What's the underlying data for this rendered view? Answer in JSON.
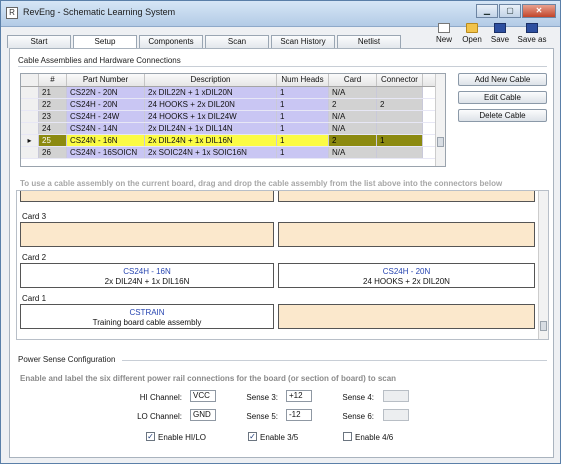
{
  "window": {
    "title": "RevEng - Schematic Learning System",
    "app_icon_glyph": "R"
  },
  "tabs": [
    {
      "label": "Start"
    },
    {
      "label": "Setup"
    },
    {
      "label": "Components"
    },
    {
      "label": "Scan"
    },
    {
      "label": "Scan History"
    },
    {
      "label": "Netlist"
    }
  ],
  "toolbar": {
    "new_label": "New",
    "open_label": "Open",
    "save_label": "Save",
    "save_as_label": "Save as"
  },
  "cables": {
    "section_title": "Cable Assemblies and Hardware Connections",
    "columns": [
      "#",
      "Part Number",
      "Description",
      "Num Heads",
      "Card",
      "Connector"
    ],
    "selected_marker": "▸",
    "rows": [
      {
        "num": "21",
        "part": "CS22N - 20N",
        "desc": "2x DIL22N + 1 xDIL20N",
        "heads": "1",
        "card": "N/A",
        "conn": ""
      },
      {
        "num": "22",
        "part": "CS24H - 20N",
        "desc": "24 HOOKS + 2x DIL20N",
        "heads": "1",
        "card": "2",
        "conn": "2"
      },
      {
        "num": "23",
        "part": "CS24H - 24W",
        "desc": "24 HOOKS + 1x DIL24W",
        "heads": "1",
        "card": "N/A",
        "conn": ""
      },
      {
        "num": "24",
        "part": "CS24N - 14N",
        "desc": "2x DIL24N + 1x DIL14N",
        "heads": "1",
        "card": "N/A",
        "conn": ""
      },
      {
        "num": "25",
        "part": "CS24N - 16N",
        "desc": "2x DIL24N + 1x DIL16N",
        "heads": "1",
        "card": "2",
        "conn": "1"
      },
      {
        "num": "26",
        "part": "CS24N - 16SOICN",
        "desc": "2x SOIC24N + 1x SOIC16N",
        "heads": "1",
        "card": "N/A",
        "conn": ""
      }
    ],
    "selected_index": 4,
    "buttons": {
      "add": "Add New Cable",
      "edit": "Edit Cable",
      "delete": "Delete Cable"
    },
    "drag_hint": "To use a cable assembly on the current board, drag and drop the cable assembly from the list above into the connectors below"
  },
  "cards": {
    "card3": {
      "title": "Card 3"
    },
    "card2": {
      "title": "Card 2",
      "slot1": {
        "name": "CS24H - 16N",
        "desc": "2x DIL24N + 1x DIL16N"
      },
      "slot2": {
        "name": "CS24H - 20N",
        "desc": "24 HOOKS + 2x DIL20N"
      }
    },
    "card1": {
      "title": "Card 1",
      "slot1": {
        "name": "CSTRAIN",
        "desc": "Training board cable assembly"
      }
    }
  },
  "power": {
    "section_title": "Power Sense Configuration",
    "hint": "Enable and label the six different power rail connections for the board (or section of board) to scan",
    "hi_label": "HI Channel:",
    "hi_value": "VCC",
    "lo_label": "LO Channel:",
    "lo_value": "GND",
    "s3_label": "Sense 3:",
    "s3_value": "+12",
    "s5_label": "Sense 5:",
    "s5_value": "-12",
    "s4_label": "Sense 4:",
    "s4_value": "",
    "s6_label": "Sense 6:",
    "s6_value": "",
    "enable_hilo": {
      "label": "Enable HI/LO",
      "checked": true,
      "glyph": "✓"
    },
    "enable_35": {
      "label": "Enable 3/5",
      "checked": true,
      "glyph": "✓"
    },
    "enable_46": {
      "label": "Enable 4/6",
      "checked": false,
      "glyph": ""
    }
  }
}
